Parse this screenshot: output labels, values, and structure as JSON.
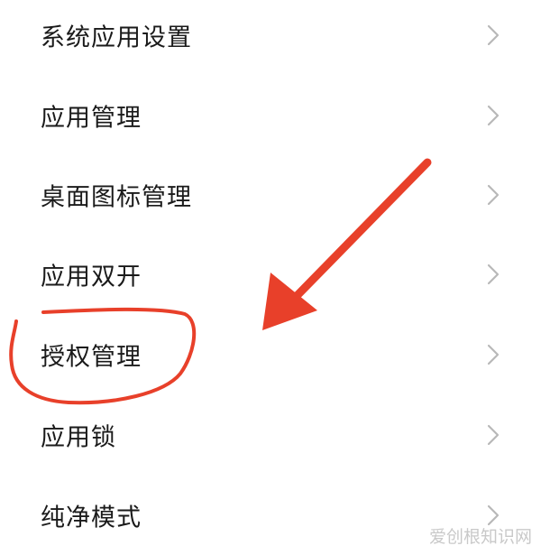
{
  "menu": {
    "items": [
      {
        "label": "系统应用设置"
      },
      {
        "label": "应用管理"
      },
      {
        "label": "桌面图标管理"
      },
      {
        "label": "应用双开"
      },
      {
        "label": "授权管理"
      },
      {
        "label": "应用锁"
      },
      {
        "label": "纯净模式"
      }
    ],
    "chevron_icon": "chevron-right-icon",
    "chevron_color": "#b8b8b8"
  },
  "annotation": {
    "arrow_icon": "red-arrow-icon",
    "circle_icon": "red-circle-highlight-icon",
    "color": "#e8402a"
  },
  "watermark": {
    "text": "爱创根知识网"
  }
}
